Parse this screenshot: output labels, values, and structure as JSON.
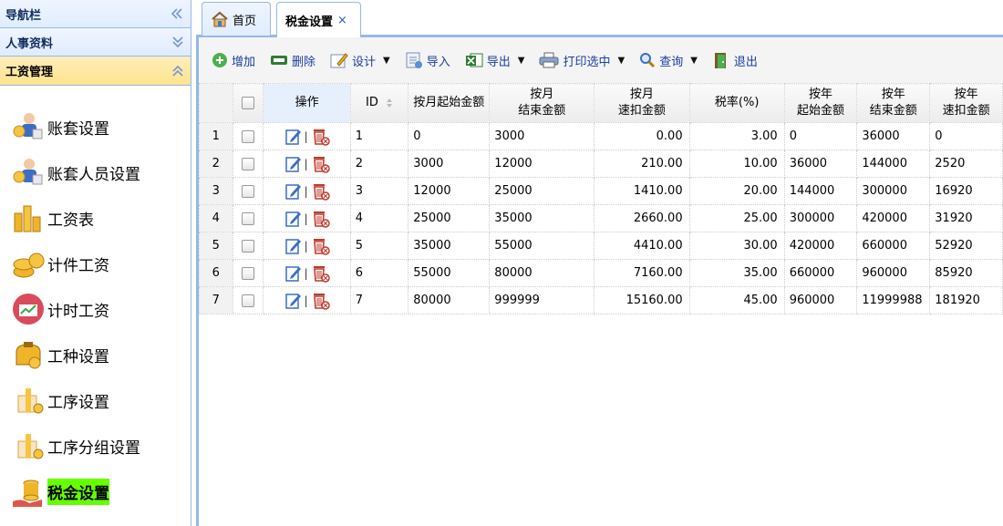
{
  "sidebar": {
    "nav_title": "导航栏",
    "sections": [
      {
        "label": "人事资料"
      },
      {
        "label": "工资管理"
      }
    ],
    "items": [
      {
        "label": "账套设置",
        "icon": "accounting-person-icon"
      },
      {
        "label": "账套人员设置",
        "icon": "accounting-person-icon"
      },
      {
        "label": "工资表",
        "icon": "coins-stack-icon"
      },
      {
        "label": "计件工资",
        "icon": "coin-pile-icon"
      },
      {
        "label": "计时工资",
        "icon": "chart-circle-icon"
      },
      {
        "label": "工种设置",
        "icon": "purse-icon"
      },
      {
        "label": "工序设置",
        "icon": "gift-coins-icon"
      },
      {
        "label": "工序分组设置",
        "icon": "gift-coins-icon"
      },
      {
        "label": "税金设置",
        "icon": "hand-coins-icon"
      }
    ]
  },
  "tabs": {
    "home": "首页",
    "current": "税金设置",
    "close_glyph": "×"
  },
  "toolbar": {
    "add": "增加",
    "delete": "删除",
    "design": "设计",
    "import": "导入",
    "export": "导出",
    "print": "打印选中",
    "query": "查询",
    "exit": "退出"
  },
  "grid": {
    "headers": {
      "ops": "操作",
      "id": "ID",
      "m_start": "按月起始金额",
      "m_end_1": "按月",
      "m_end_2": "结束金额",
      "m_quick_1": "按月",
      "m_quick_2": "速扣金额",
      "rate": "税率(%)",
      "y_start_1": "按年",
      "y_start_2": "起始金额",
      "y_end_1": "按年",
      "y_end_2": "结束金额",
      "y_quick_1": "按年",
      "y_quick_2": "速扣金额"
    },
    "rows": [
      {
        "rn": "1",
        "id": "1",
        "m_start": "0",
        "m_end": "3000",
        "m_quick": "0.00",
        "rate": "3.00",
        "y_start": "0",
        "y_end": "36000",
        "y_quick": "0"
      },
      {
        "rn": "2",
        "id": "2",
        "m_start": "3000",
        "m_end": "12000",
        "m_quick": "210.00",
        "rate": "10.00",
        "y_start": "36000",
        "y_end": "144000",
        "y_quick": "2520"
      },
      {
        "rn": "3",
        "id": "3",
        "m_start": "12000",
        "m_end": "25000",
        "m_quick": "1410.00",
        "rate": "20.00",
        "y_start": "144000",
        "y_end": "300000",
        "y_quick": "16920"
      },
      {
        "rn": "4",
        "id": "4",
        "m_start": "25000",
        "m_end": "35000",
        "m_quick": "2660.00",
        "rate": "25.00",
        "y_start": "300000",
        "y_end": "420000",
        "y_quick": "31920"
      },
      {
        "rn": "5",
        "id": "5",
        "m_start": "35000",
        "m_end": "55000",
        "m_quick": "4410.00",
        "rate": "30.00",
        "y_start": "420000",
        "y_end": "660000",
        "y_quick": "52920"
      },
      {
        "rn": "6",
        "id": "6",
        "m_start": "55000",
        "m_end": "80000",
        "m_quick": "7160.00",
        "rate": "35.00",
        "y_start": "660000",
        "y_end": "960000",
        "y_quick": "85920"
      },
      {
        "rn": "7",
        "id": "7",
        "m_start": "80000",
        "m_end": "999999",
        "m_quick": "15160.00",
        "rate": "45.00",
        "y_start": "960000",
        "y_end": "11999988",
        "y_quick": "181920"
      }
    ]
  },
  "colors": {
    "border": "#95b8e7",
    "selected_highlight": "#66ff00",
    "active_section": "#ffe48d"
  }
}
